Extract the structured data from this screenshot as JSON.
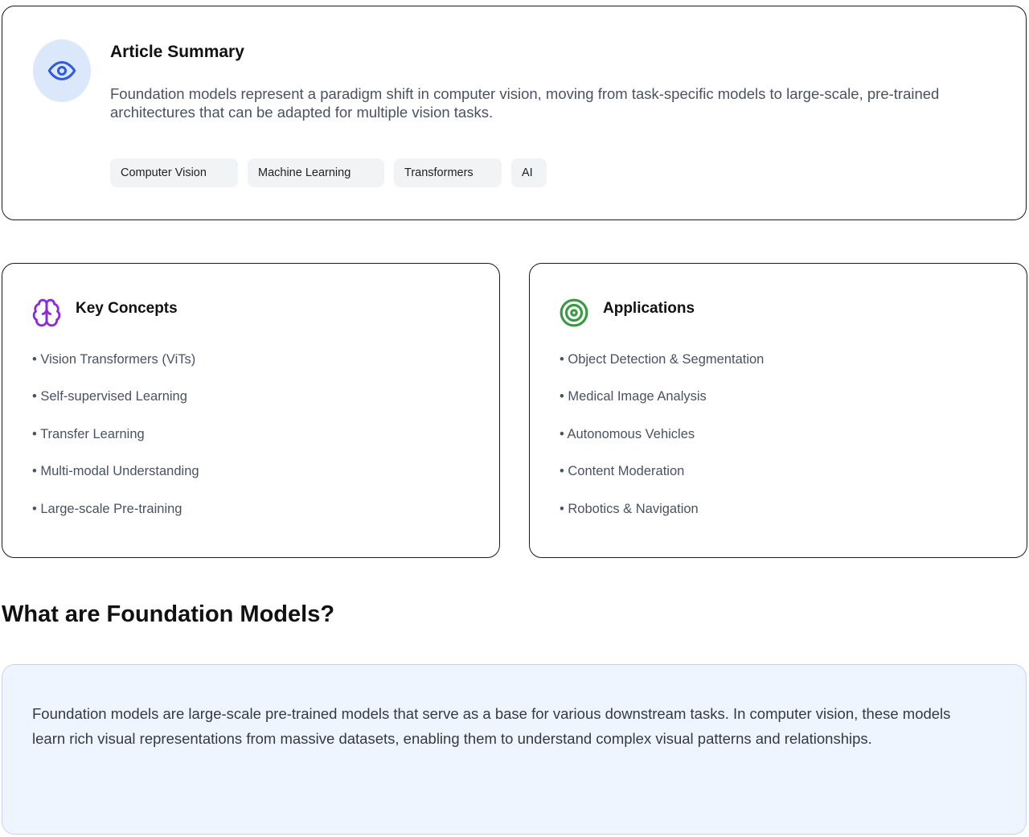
{
  "summary": {
    "icon": "eye-icon",
    "title": "Article Summary",
    "text": "Foundation models represent a paradigm shift in computer vision, moving from task-specific models to large-scale, pre-trained architectures that can be adapted for multiple vision tasks.",
    "tags": [
      "Computer Vision",
      "Machine Learning",
      "Transformers",
      "AI"
    ]
  },
  "concepts": {
    "icon": "brain-icon",
    "title": "Key Concepts",
    "items": [
      "Vision Transformers (ViTs)",
      "Self-supervised Learning",
      "Transfer Learning",
      "Multi-modal Understanding",
      "Large-scale Pre-training"
    ]
  },
  "applications": {
    "icon": "target-icon",
    "title": "Applications",
    "items": [
      "Object Detection & Segmentation",
      "Medical Image Analysis",
      "Autonomous Vehicles",
      "Content Moderation",
      "Robotics & Navigation"
    ]
  },
  "section": {
    "title": "What are Foundation Models?",
    "text": "Foundation models are large-scale pre-trained models that serve as a base for various downstream tasks. In computer vision, these models learn rich visual representations from massive datasets, enabling them to understand complex visual patterns and relationships."
  },
  "colors": {
    "eye_accent": "#2f5be0",
    "brain_accent": "#8a2be2",
    "target_accent": "#3a9a42",
    "badge_bg": "#dbe8fc",
    "info_bg": "#eef5fe"
  }
}
